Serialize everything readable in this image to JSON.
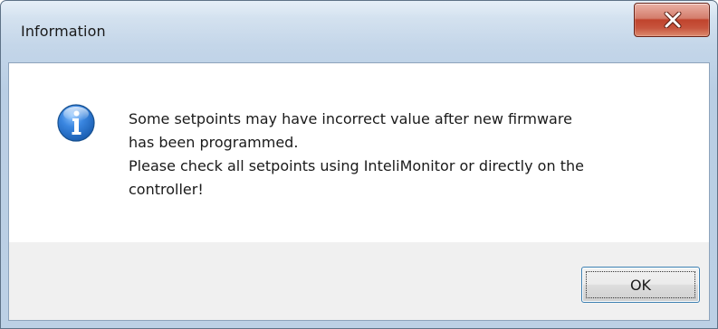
{
  "window": {
    "title": "Information"
  },
  "titlebar": {
    "close_icon": "close-x-icon"
  },
  "message": {
    "icon": "information-icon",
    "lines": [
      "Some setpoints may have incorrect value after new firmware",
      "has been programmed.",
      "Please check all setpoints using InteliMonitor or directly on the",
      "controller!"
    ]
  },
  "buttons": {
    "ok_label": "OK"
  },
  "colors": {
    "close_button_red": "#c7553e",
    "info_icon_blue": "#1b5fb3",
    "focus_border_blue": "#3c7fb1"
  }
}
